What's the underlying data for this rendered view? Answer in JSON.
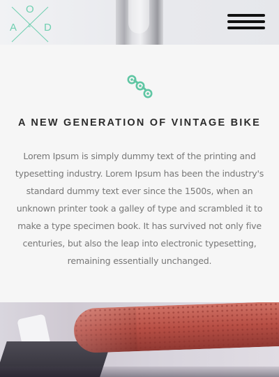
{
  "header": {
    "logo": {
      "letters": {
        "a": "A",
        "o": "O",
        "d": "D",
        "amp": "&"
      },
      "accent_color": "#6fcfb0"
    },
    "menu_icon": "hamburger-menu-icon"
  },
  "intro": {
    "icon": "bike-chain-icon",
    "icon_color": "#5fc6a3",
    "headline": "A NEW GENERATION OF VINTAGE BIKE",
    "body": "Lorem Ipsum is simply dummy text of the printing and typesetting industry. Lorem Ipsum has been the industry's standard dummy text ever since the 1500s, when an unknown printer took a galley of type and scrambled it to make a type specimen book. It has survived not only five centuries, but also the leap into electronic typesetting, remaining essentially unchanged."
  },
  "colors": {
    "background": "#f6f6f6",
    "headline": "#2b2b2b",
    "body_text": "#777777"
  }
}
